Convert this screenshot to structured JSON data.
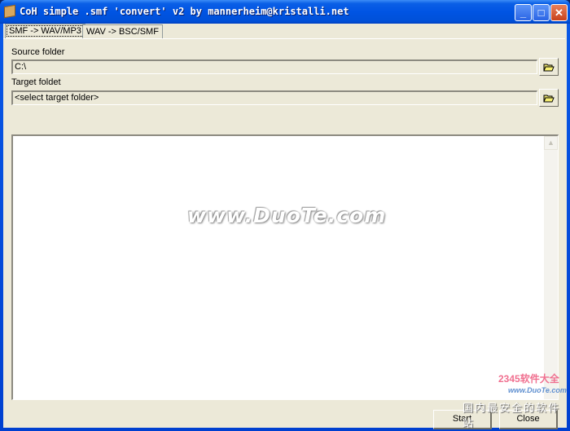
{
  "window": {
    "title": "CoH simple .smf 'convert' v2 by mannerheim@kristalli.net",
    "minimize": "_",
    "maximize": "□",
    "close": "✕"
  },
  "tabs": [
    {
      "label": "SMF -> WAV/MP3",
      "active": true
    },
    {
      "label": "WAV -> BSC/SMF",
      "active": false
    }
  ],
  "source": {
    "label": "Source folder",
    "value": "C:\\",
    "browse_icon": "folder-open-icon"
  },
  "target": {
    "label": "Target foldet",
    "value": "<select target folder>",
    "browse_icon": "folder-open-icon"
  },
  "log": {
    "value": ""
  },
  "buttons": {
    "start": "Start",
    "close": "Close"
  },
  "watermark": {
    "center": "www.DuoTe.com",
    "brand": "2345软件大全",
    "url": "www.DuoTe.com",
    "slogan": "国内最安全的软件站"
  }
}
